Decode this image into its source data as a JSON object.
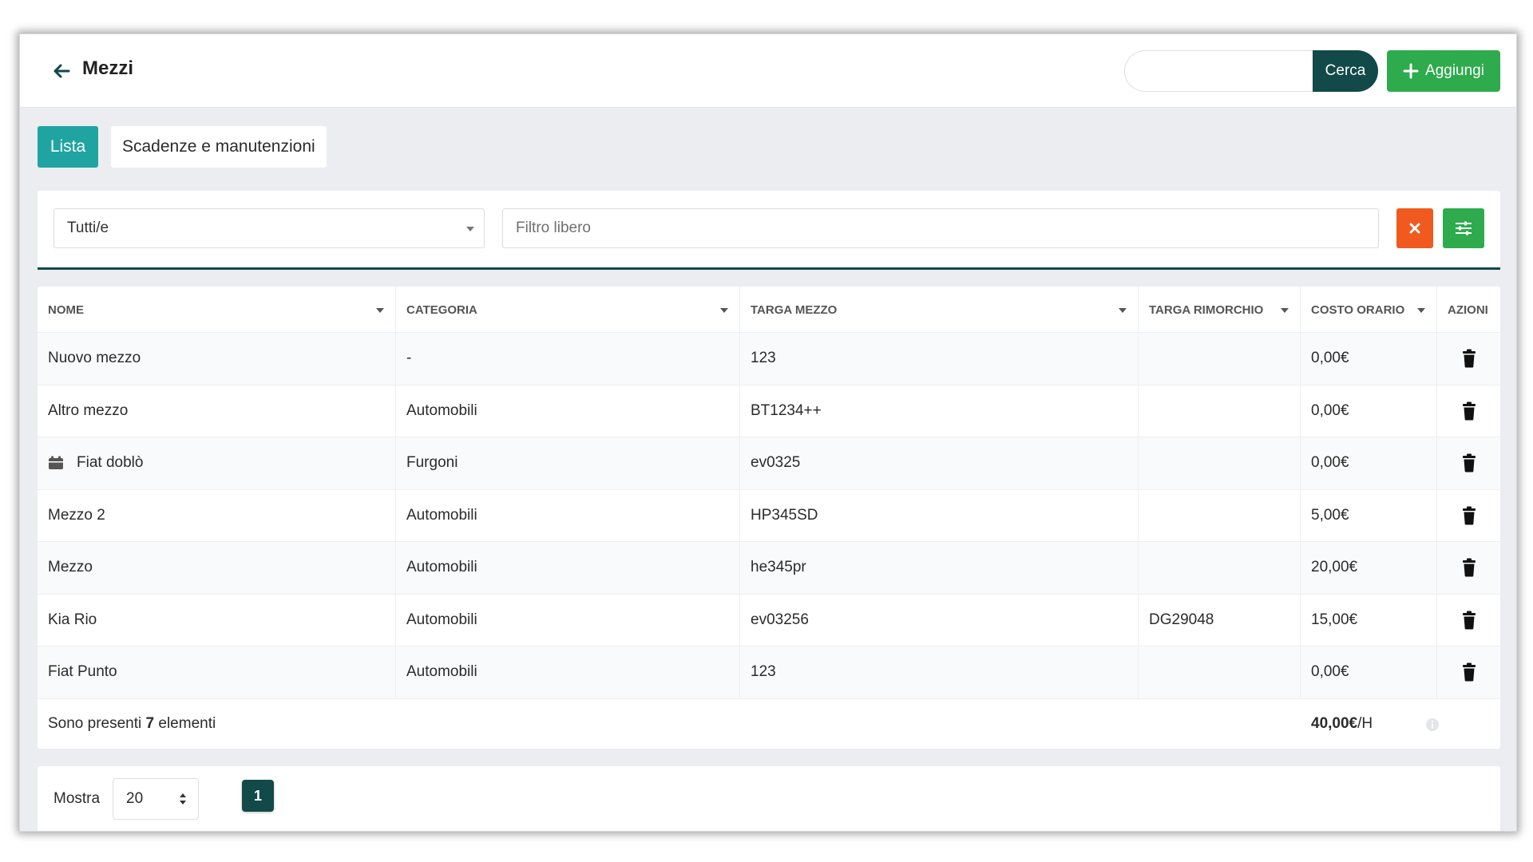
{
  "header": {
    "title": "Mezzi",
    "search_placeholder": "",
    "search_button": "Cerca",
    "add_button": "Aggiungi"
  },
  "tabs": [
    {
      "label": "Lista",
      "active": true
    },
    {
      "label": "Scadenze e manutenzioni",
      "active": false
    }
  ],
  "filters": {
    "category_selected": "Tutti/e",
    "free_filter_placeholder": "Filtro libero"
  },
  "table": {
    "columns": [
      "NOME",
      "CATEGORIA",
      "TARGA MEZZO",
      "TARGA RIMORCHIO",
      "COSTO ORARIO",
      "AZIONI"
    ],
    "rows": [
      {
        "nome": "Nuovo mezzo",
        "categoria": "-",
        "targa_mezzo": "123",
        "targa_rimorchio": "",
        "costo_orario": "0,00€",
        "icon": ""
      },
      {
        "nome": "Altro mezzo",
        "categoria": "Automobili",
        "targa_mezzo": "BT1234++",
        "targa_rimorchio": "",
        "costo_orario": "0,00€",
        "icon": ""
      },
      {
        "nome": "Fiat doblò",
        "categoria": "Furgoni",
        "targa_mezzo": "ev0325",
        "targa_rimorchio": "",
        "costo_orario": "0,00€",
        "icon": "calendar-icon"
      },
      {
        "nome": "Mezzo 2",
        "categoria": "Automobili",
        "targa_mezzo": "HP345SD",
        "targa_rimorchio": "",
        "costo_orario": "5,00€",
        "icon": ""
      },
      {
        "nome": "Mezzo",
        "categoria": "Automobili",
        "targa_mezzo": "he345pr",
        "targa_rimorchio": "",
        "costo_orario": "20,00€",
        "icon": ""
      },
      {
        "nome": "Kia Rio",
        "categoria": "Automobili",
        "targa_mezzo": "ev03256",
        "targa_rimorchio": "DG29048",
        "costo_orario": "15,00€",
        "icon": ""
      },
      {
        "nome": "Fiat Punto",
        "categoria": "Automobili",
        "targa_mezzo": "123",
        "targa_rimorchio": "",
        "costo_orario": "0,00€",
        "icon": ""
      }
    ],
    "footer": {
      "count_prefix": "Sono presenti ",
      "count_value": "7",
      "count_suffix": " elementi",
      "total_value": "40,00€",
      "total_unit": "/H"
    }
  },
  "pager": {
    "show_label": "Mostra",
    "page_size": "20",
    "current_page": "1"
  },
  "colors": {
    "dark_teal": "#114a48",
    "teal": "#1fa4a2",
    "green": "#2dab4d",
    "orange": "#f05a1e"
  }
}
